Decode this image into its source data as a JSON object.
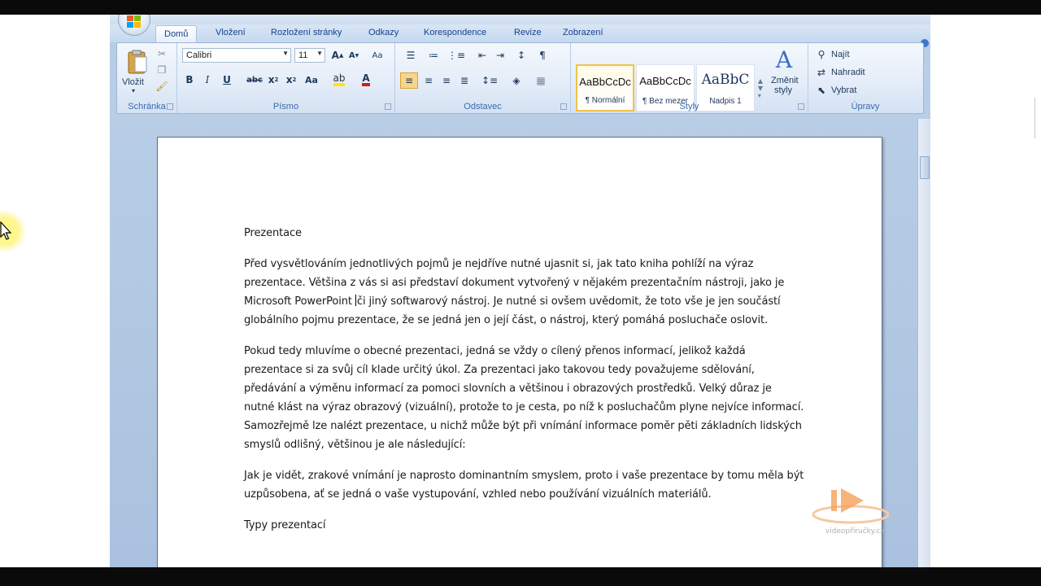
{
  "tabs": [
    {
      "label": "Domů",
      "active": true
    },
    {
      "label": "Vložení"
    },
    {
      "label": "Rozložení stránky"
    },
    {
      "label": "Odkazy"
    },
    {
      "label": "Korespondence"
    },
    {
      "label": "Revize"
    },
    {
      "label": "Zobrazení"
    }
  ],
  "ribbon": {
    "clipboard": {
      "label": "Schránka",
      "paste_label": "Vložit"
    },
    "font": {
      "label": "Písmo",
      "font_name": "Calibri",
      "font_size": "11"
    },
    "paragraph": {
      "label": "Odstavec"
    },
    "styles": {
      "label": "Styly",
      "items": [
        {
          "sample": "AaBbCcDc",
          "name": "¶ Normální",
          "selected": true
        },
        {
          "sample": "AaBbCcDc",
          "name": "¶ Bez mezer"
        },
        {
          "sample": "AaBbC",
          "name": "Nadpis 1"
        }
      ],
      "change_styles_line1": "Změnit",
      "change_styles_line2": "styly"
    },
    "editing": {
      "label": "Úpravy",
      "find": "Najít",
      "replace": "Nahradit",
      "select": "Vybrat"
    }
  },
  "document": {
    "heading": "Prezentace",
    "p1_before_caret": "Před vysvětlováním jednotlivých pojmů je nejdříve nutné ujasnit si, jak tato kniha pohlíží na výraz prezentace. Většina z vás si asi představí dokument vytvořený v nějakém prezentačním nástroji, jako je Microsoft PowerPoint ",
    "p1_after_caret": "či jiný softwarový nástroj. Je nutné si ovšem uvědomit, že toto vše je jen součástí globálního pojmu prezentace, že se jedná jen o její část, o nástroj, který pomáhá posluchače oslovit.",
    "p2": "Pokud tedy mluvíme o obecné prezentaci, jedná se vždy o cílený přenos informací, jelikož každá prezentace si za svůj cíl klade určitý úkol. Za prezentaci jako takovou tedy považujeme sdělování, předávání a výměnu informací za pomoci slovních a většinou i obrazových prostředků. Velký důraz je nutné klást na výraz obrazový (vizuální), protože to je cesta, po níž k posluchačům plyne nejvíce informací. Samozřejmě lze nalézt prezentace, u nichž může být při vnímání informace poměr pěti základních lidských smyslů odlišný, většinou je ale následující:",
    "p3": "Jak je vidět, zrakové vnímání je naprosto dominantním smyslem, proto i vaše prezentace by tomu měla být uzpůsobena, ať se jedná o vaše vystupování, vzhled nebo používání vizuálních materiálů.",
    "heading2": "Typy prezentací"
  },
  "watermark_text": "videopříručky.cz",
  "colors": {
    "ribbon_text": "#1e395b",
    "group_label": "#3e6aaa",
    "accent_orange": "#f4a15a"
  }
}
